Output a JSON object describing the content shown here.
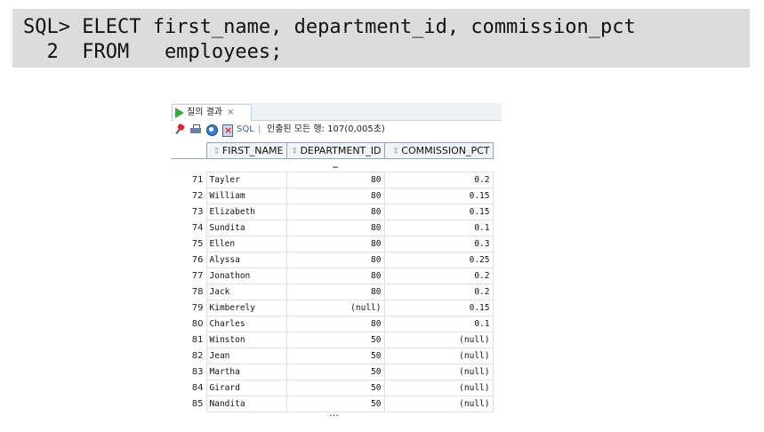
{
  "sql": {
    "line1": "SQL> ELECT first_name, department_id, commission_pct",
    "line2": "  2  FROM   employees;"
  },
  "panel": {
    "tab_label": "질의 결과",
    "tab_close": "×",
    "toolbar_sql": "SQL",
    "toolbar_sep": "|",
    "fetch_status": "인출된 모든 행: 107(0,005초)"
  },
  "columns": [
    "FIRST_NAME",
    "DEPARTMENT_ID",
    "COMMISSION_PCT"
  ],
  "top_ellipsis": "…",
  "bottom_ellipsis": "…",
  "rows": [
    {
      "n": "71",
      "first_name": "Tayler",
      "dept": "80",
      "comm": "0.2"
    },
    {
      "n": "72",
      "first_name": "William",
      "dept": "80",
      "comm": "0.15"
    },
    {
      "n": "73",
      "first_name": "Elizabeth",
      "dept": "80",
      "comm": "0.15"
    },
    {
      "n": "74",
      "first_name": "Sundita",
      "dept": "80",
      "comm": "0.1"
    },
    {
      "n": "75",
      "first_name": "Ellen",
      "dept": "80",
      "comm": "0.3"
    },
    {
      "n": "76",
      "first_name": "Alyssa",
      "dept": "80",
      "comm": "0.25"
    },
    {
      "n": "77",
      "first_name": "Jonathon",
      "dept": "80",
      "comm": "0.2"
    },
    {
      "n": "78",
      "first_name": "Jack",
      "dept": "80",
      "comm": "0.2"
    },
    {
      "n": "79",
      "first_name": "Kimberely",
      "dept": "(null)",
      "comm": "0.15"
    },
    {
      "n": "80",
      "first_name": "Charles",
      "dept": "80",
      "comm": "0.1"
    },
    {
      "n": "81",
      "first_name": "Winston",
      "dept": "50",
      "comm": "(null)"
    },
    {
      "n": "82",
      "first_name": "Jean",
      "dept": "50",
      "comm": "(null)"
    },
    {
      "n": "83",
      "first_name": "Martha",
      "dept": "50",
      "comm": "(null)"
    },
    {
      "n": "84",
      "first_name": "Girard",
      "dept": "50",
      "comm": "(null)"
    },
    {
      "n": "85",
      "first_name": "Nandita",
      "dept": "50",
      "comm": "(null)"
    }
  ]
}
